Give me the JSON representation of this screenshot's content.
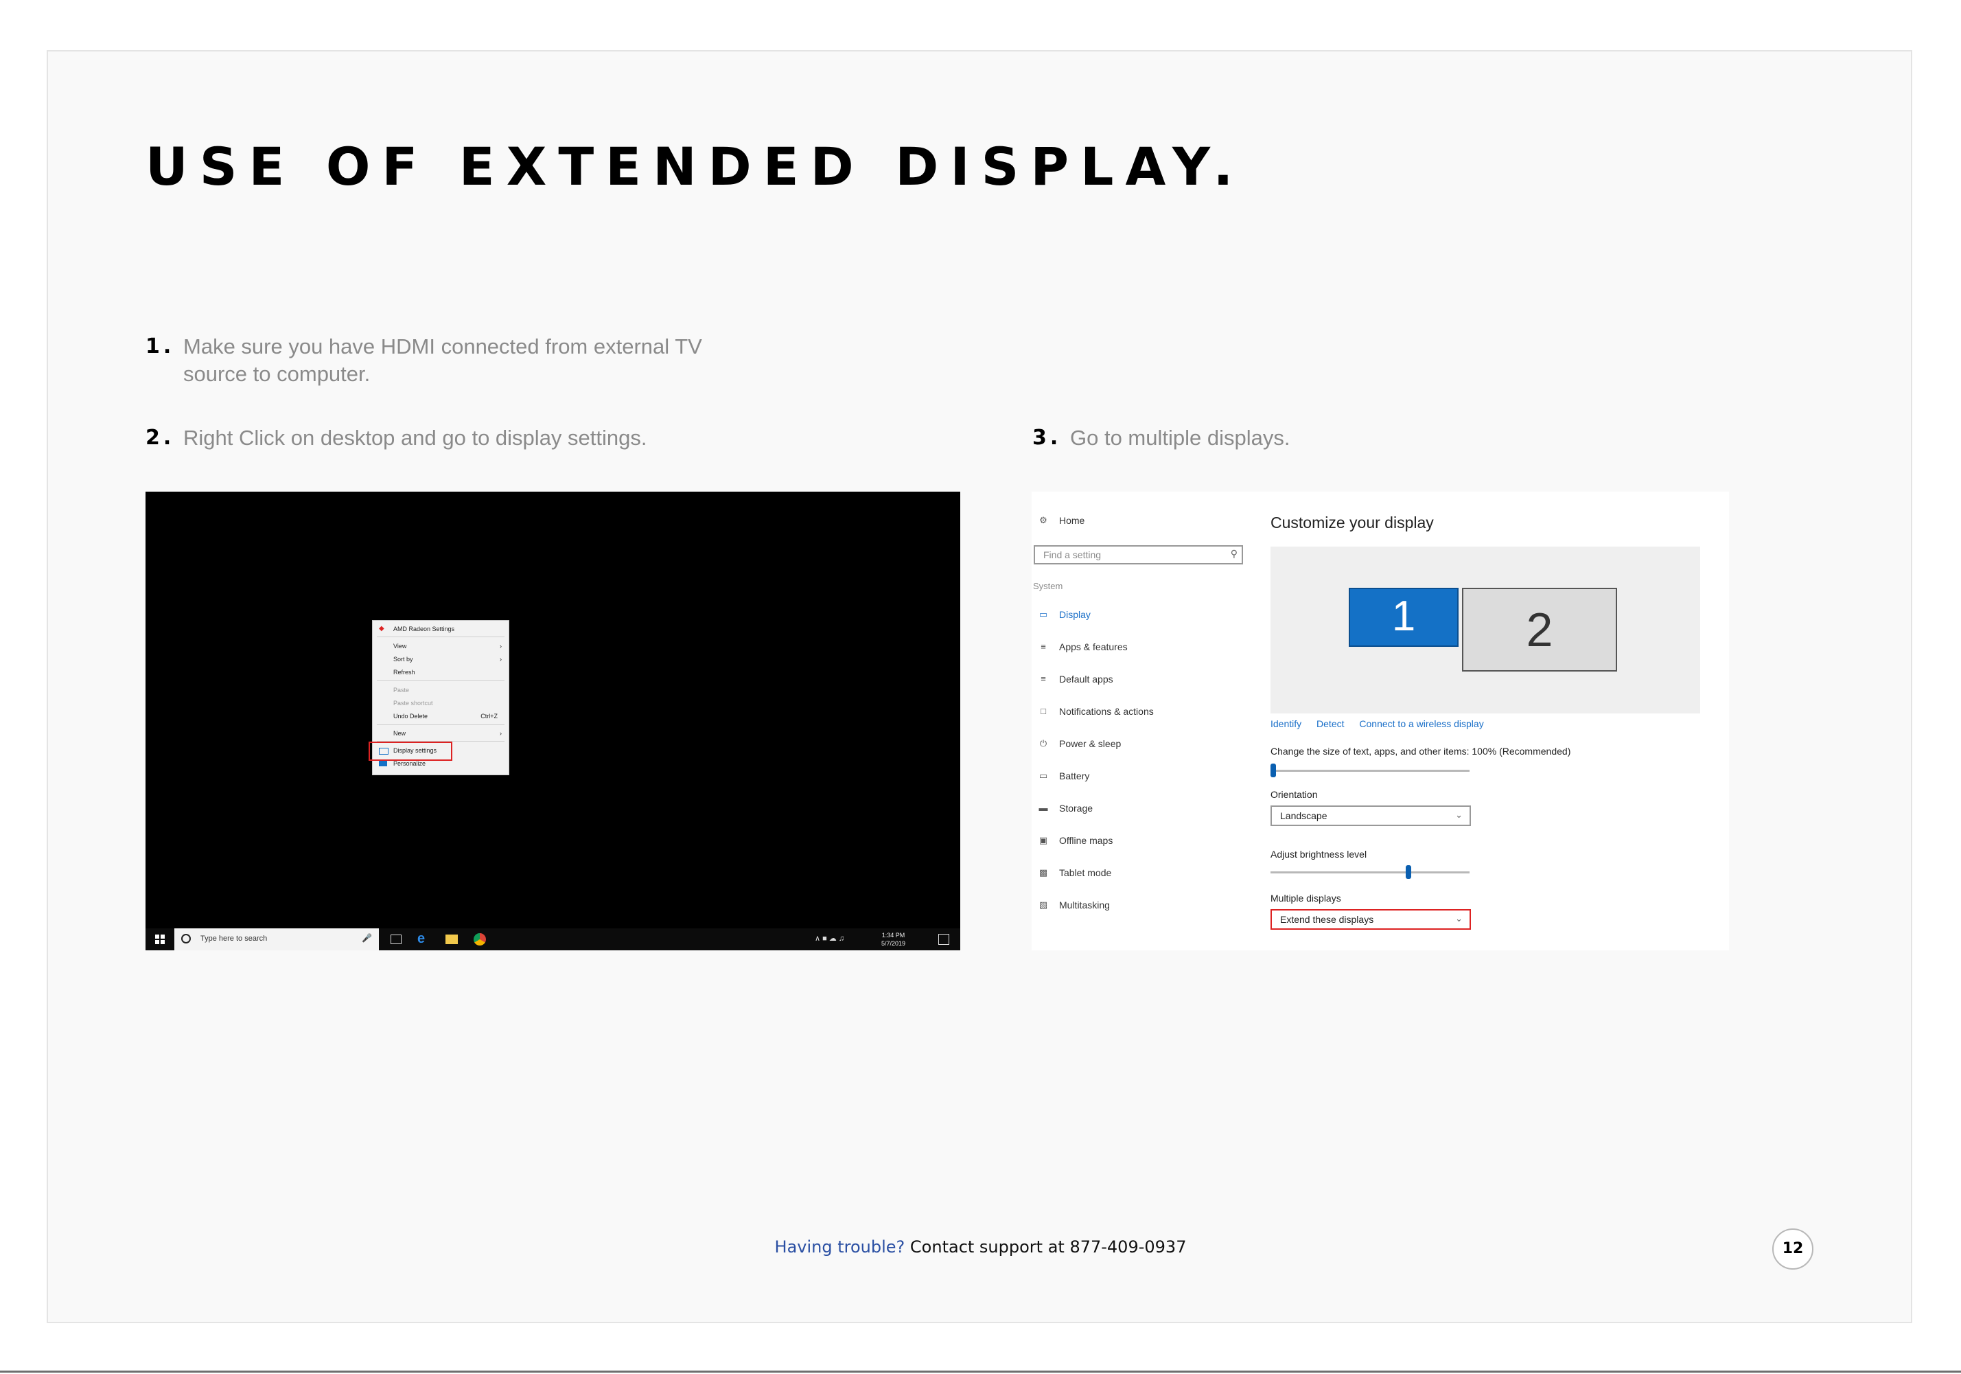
{
  "title": "USE OF EXTENDED DISPLAY.",
  "steps": [
    {
      "num": "1.",
      "text": "Make sure you have HDMI connected from external TV source to computer."
    },
    {
      "num": "2.",
      "text": "Right Click on desktop and go to display settings."
    },
    {
      "num": "3.",
      "text": "Go to multiple displays."
    }
  ],
  "desktop": {
    "menu": {
      "radeon": "AMD Radeon Settings",
      "view": "View",
      "sort_by": "Sort by",
      "refresh": "Refresh",
      "paste": "Paste",
      "paste_shortcut": "Paste shortcut",
      "undo_delete": "Undo Delete",
      "undo_shortcut": "Ctrl+Z",
      "new": "New",
      "display_settings": "Display settings",
      "personalize": "Personalize"
    },
    "taskbar": {
      "search_placeholder": "Type here to search",
      "time": "1:34 PM",
      "date": "5/7/2019"
    }
  },
  "settings": {
    "nav": {
      "home": "Home",
      "find_placeholder": "Find a setting",
      "system_label": "System",
      "display": "Display",
      "apps": "Apps & features",
      "default_apps": "Default apps",
      "notifications": "Notifications & actions",
      "power": "Power & sleep",
      "battery": "Battery",
      "storage": "Storage",
      "offline_maps": "Offline maps",
      "tablet_mode": "Tablet mode",
      "multitasking": "Multitasking"
    },
    "title": "Customize your display",
    "monitor1": "1",
    "monitor2": "2",
    "links": {
      "identify": "Identify",
      "detect": "Detect",
      "connect": "Connect to a wireless display"
    },
    "scale_label": "Change the size of text, apps, and other items: 100% (Recommended)",
    "orientation_label": "Orientation",
    "orientation_value": "Landscape",
    "brightness_label": "Adjust brightness level",
    "brightness_level": 0.7,
    "multiple_label": "Multiple displays",
    "multiple_value": "Extend these displays"
  },
  "footer": {
    "accent": "Having trouble?",
    "text": "Contact support at 877-409-0937"
  },
  "page_number": "12",
  "colors": {
    "accent_blue": "#1471c6",
    "highlight_red": "#dd2222",
    "footer_blue": "#2a4fa3"
  }
}
